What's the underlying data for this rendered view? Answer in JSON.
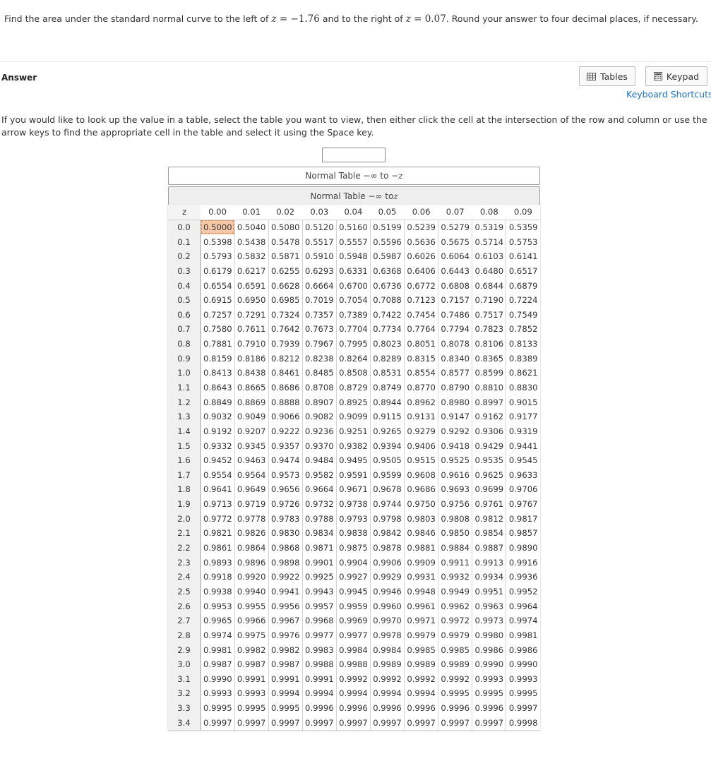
{
  "question": {
    "prefix": "Find the area under the standard normal curve to the left of",
    "z1_var": "z",
    "z1_eq": " = −1.76",
    "middle": "and to the right of",
    "z2_var": "z",
    "z2_eq": " = 0.07",
    "suffix": ". Round your answer to four decimal places, if necessary."
  },
  "answer_label": "Answer",
  "buttons": {
    "tables": "Tables",
    "keypad": "Keypad"
  },
  "keyboard_shortcuts": "Keyboard Shortcuts",
  "instructions": "If you would like to look up the value in a table, select the table you want to view, then either click the cell at the intersection of the row and column or use the arrow keys to find the appropriate cell in the table and select it using the Space key.",
  "answer_value": "",
  "tabs": {
    "t1_prefix": "Normal Table −∞ to −",
    "t1_var": "z",
    "t2_prefix": "Normal Table −∞ to ",
    "t2_var": "z"
  },
  "table": {
    "z_header": "z",
    "columns": [
      "0.00",
      "0.01",
      "0.02",
      "0.03",
      "0.04",
      "0.05",
      "0.06",
      "0.07",
      "0.08",
      "0.09"
    ],
    "selected_cell": "0.5000",
    "rows": [
      {
        "z": "0.0",
        "v": [
          "0.5000",
          "0.5040",
          "0.5080",
          "0.5120",
          "0.5160",
          "0.5199",
          "0.5239",
          "0.5279",
          "0.5319",
          "0.5359"
        ]
      },
      {
        "z": "0.1",
        "v": [
          "0.5398",
          "0.5438",
          "0.5478",
          "0.5517",
          "0.5557",
          "0.5596",
          "0.5636",
          "0.5675",
          "0.5714",
          "0.5753"
        ]
      },
      {
        "z": "0.2",
        "v": [
          "0.5793",
          "0.5832",
          "0.5871",
          "0.5910",
          "0.5948",
          "0.5987",
          "0.6026",
          "0.6064",
          "0.6103",
          "0.6141"
        ]
      },
      {
        "z": "0.3",
        "v": [
          "0.6179",
          "0.6217",
          "0.6255",
          "0.6293",
          "0.6331",
          "0.6368",
          "0.6406",
          "0.6443",
          "0.6480",
          "0.6517"
        ]
      },
      {
        "z": "0.4",
        "v": [
          "0.6554",
          "0.6591",
          "0.6628",
          "0.6664",
          "0.6700",
          "0.6736",
          "0.6772",
          "0.6808",
          "0.6844",
          "0.6879"
        ]
      },
      {
        "z": "0.5",
        "v": [
          "0.6915",
          "0.6950",
          "0.6985",
          "0.7019",
          "0.7054",
          "0.7088",
          "0.7123",
          "0.7157",
          "0.7190",
          "0.7224"
        ]
      },
      {
        "z": "0.6",
        "v": [
          "0.7257",
          "0.7291",
          "0.7324",
          "0.7357",
          "0.7389",
          "0.7422",
          "0.7454",
          "0.7486",
          "0.7517",
          "0.7549"
        ]
      },
      {
        "z": "0.7",
        "v": [
          "0.7580",
          "0.7611",
          "0.7642",
          "0.7673",
          "0.7704",
          "0.7734",
          "0.7764",
          "0.7794",
          "0.7823",
          "0.7852"
        ]
      },
      {
        "z": "0.8",
        "v": [
          "0.7881",
          "0.7910",
          "0.7939",
          "0.7967",
          "0.7995",
          "0.8023",
          "0.8051",
          "0.8078",
          "0.8106",
          "0.8133"
        ]
      },
      {
        "z": "0.9",
        "v": [
          "0.8159",
          "0.8186",
          "0.8212",
          "0.8238",
          "0.8264",
          "0.8289",
          "0.8315",
          "0.8340",
          "0.8365",
          "0.8389"
        ]
      },
      {
        "z": "1.0",
        "v": [
          "0.8413",
          "0.8438",
          "0.8461",
          "0.8485",
          "0.8508",
          "0.8531",
          "0.8554",
          "0.8577",
          "0.8599",
          "0.8621"
        ]
      },
      {
        "z": "1.1",
        "v": [
          "0.8643",
          "0.8665",
          "0.8686",
          "0.8708",
          "0.8729",
          "0.8749",
          "0.8770",
          "0.8790",
          "0.8810",
          "0.8830"
        ]
      },
      {
        "z": "1.2",
        "v": [
          "0.8849",
          "0.8869",
          "0.8888",
          "0.8907",
          "0.8925",
          "0.8944",
          "0.8962",
          "0.8980",
          "0.8997",
          "0.9015"
        ]
      },
      {
        "z": "1.3",
        "v": [
          "0.9032",
          "0.9049",
          "0.9066",
          "0.9082",
          "0.9099",
          "0.9115",
          "0.9131",
          "0.9147",
          "0.9162",
          "0.9177"
        ]
      },
      {
        "z": "1.4",
        "v": [
          "0.9192",
          "0.9207",
          "0.9222",
          "0.9236",
          "0.9251",
          "0.9265",
          "0.9279",
          "0.9292",
          "0.9306",
          "0.9319"
        ]
      },
      {
        "z": "1.5",
        "v": [
          "0.9332",
          "0.9345",
          "0.9357",
          "0.9370",
          "0.9382",
          "0.9394",
          "0.9406",
          "0.9418",
          "0.9429",
          "0.9441"
        ]
      },
      {
        "z": "1.6",
        "v": [
          "0.9452",
          "0.9463",
          "0.9474",
          "0.9484",
          "0.9495",
          "0.9505",
          "0.9515",
          "0.9525",
          "0.9535",
          "0.9545"
        ]
      },
      {
        "z": "1.7",
        "v": [
          "0.9554",
          "0.9564",
          "0.9573",
          "0.9582",
          "0.9591",
          "0.9599",
          "0.9608",
          "0.9616",
          "0.9625",
          "0.9633"
        ]
      },
      {
        "z": "1.8",
        "v": [
          "0.9641",
          "0.9649",
          "0.9656",
          "0.9664",
          "0.9671",
          "0.9678",
          "0.9686",
          "0.9693",
          "0.9699",
          "0.9706"
        ]
      },
      {
        "z": "1.9",
        "v": [
          "0.9713",
          "0.9719",
          "0.9726",
          "0.9732",
          "0.9738",
          "0.9744",
          "0.9750",
          "0.9756",
          "0.9761",
          "0.9767"
        ]
      },
      {
        "z": "2.0",
        "v": [
          "0.9772",
          "0.9778",
          "0.9783",
          "0.9788",
          "0.9793",
          "0.9798",
          "0.9803",
          "0.9808",
          "0.9812",
          "0.9817"
        ]
      },
      {
        "z": "2.1",
        "v": [
          "0.9821",
          "0.9826",
          "0.9830",
          "0.9834",
          "0.9838",
          "0.9842",
          "0.9846",
          "0.9850",
          "0.9854",
          "0.9857"
        ]
      },
      {
        "z": "2.2",
        "v": [
          "0.9861",
          "0.9864",
          "0.9868",
          "0.9871",
          "0.9875",
          "0.9878",
          "0.9881",
          "0.9884",
          "0.9887",
          "0.9890"
        ]
      },
      {
        "z": "2.3",
        "v": [
          "0.9893",
          "0.9896",
          "0.9898",
          "0.9901",
          "0.9904",
          "0.9906",
          "0.9909",
          "0.9911",
          "0.9913",
          "0.9916"
        ]
      },
      {
        "z": "2.4",
        "v": [
          "0.9918",
          "0.9920",
          "0.9922",
          "0.9925",
          "0.9927",
          "0.9929",
          "0.9931",
          "0.9932",
          "0.9934",
          "0.9936"
        ]
      },
      {
        "z": "2.5",
        "v": [
          "0.9938",
          "0.9940",
          "0.9941",
          "0.9943",
          "0.9945",
          "0.9946",
          "0.9948",
          "0.9949",
          "0.9951",
          "0.9952"
        ]
      },
      {
        "z": "2.6",
        "v": [
          "0.9953",
          "0.9955",
          "0.9956",
          "0.9957",
          "0.9959",
          "0.9960",
          "0.9961",
          "0.9962",
          "0.9963",
          "0.9964"
        ]
      },
      {
        "z": "2.7",
        "v": [
          "0.9965",
          "0.9966",
          "0.9967",
          "0.9968",
          "0.9969",
          "0.9970",
          "0.9971",
          "0.9972",
          "0.9973",
          "0.9974"
        ]
      },
      {
        "z": "2.8",
        "v": [
          "0.9974",
          "0.9975",
          "0.9976",
          "0.9977",
          "0.9977",
          "0.9978",
          "0.9979",
          "0.9979",
          "0.9980",
          "0.9981"
        ]
      },
      {
        "z": "2.9",
        "v": [
          "0.9981",
          "0.9982",
          "0.9982",
          "0.9983",
          "0.9984",
          "0.9984",
          "0.9985",
          "0.9985",
          "0.9986",
          "0.9986"
        ]
      },
      {
        "z": "3.0",
        "v": [
          "0.9987",
          "0.9987",
          "0.9987",
          "0.9988",
          "0.9988",
          "0.9989",
          "0.9989",
          "0.9989",
          "0.9990",
          "0.9990"
        ]
      },
      {
        "z": "3.1",
        "v": [
          "0.9990",
          "0.9991",
          "0.9991",
          "0.9991",
          "0.9992",
          "0.9992",
          "0.9992",
          "0.9992",
          "0.9993",
          "0.9993"
        ]
      },
      {
        "z": "3.2",
        "v": [
          "0.9993",
          "0.9993",
          "0.9994",
          "0.9994",
          "0.9994",
          "0.9994",
          "0.9994",
          "0.9995",
          "0.9995",
          "0.9995"
        ]
      },
      {
        "z": "3.3",
        "v": [
          "0.9995",
          "0.9995",
          "0.9995",
          "0.9996",
          "0.9996",
          "0.9996",
          "0.9996",
          "0.9996",
          "0.9996",
          "0.9997"
        ]
      },
      {
        "z": "3.4",
        "v": [
          "0.9997",
          "0.9997",
          "0.9997",
          "0.9997",
          "0.9997",
          "0.9997",
          "0.9997",
          "0.9997",
          "0.9997",
          "0.9998"
        ]
      }
    ]
  },
  "icons": {
    "tables": "table-grid-icon",
    "keypad": "calculator-icon"
  },
  "colors": {
    "link": "#1a73c9",
    "selected_cell": "#f7c8a7"
  }
}
